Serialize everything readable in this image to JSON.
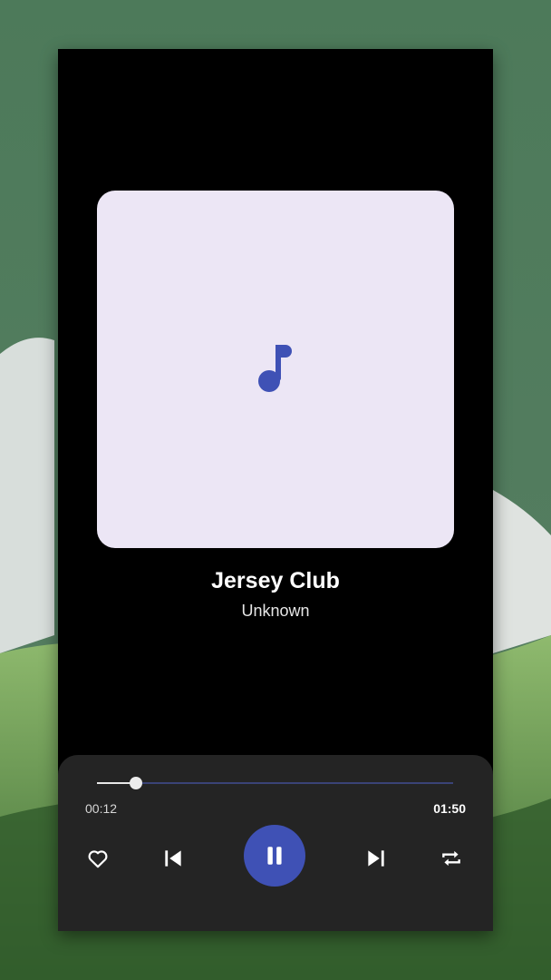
{
  "track": {
    "title": "Jersey Club",
    "artist": "Unknown"
  },
  "progress": {
    "elapsed": "00:12",
    "total": "01:50",
    "fraction": 0.11
  },
  "controls": {
    "favorite_icon": "heart-outline-icon",
    "previous_icon": "skip-previous-icon",
    "play_state_icon": "pause-icon",
    "next_icon": "skip-next-icon",
    "repeat_icon": "repeat-icon"
  },
  "artwork": {
    "icon": "music-note-icon"
  },
  "colors": {
    "accent": "#3f51b5",
    "artwork_bg": "#ece6f5",
    "player_bg": "#000000",
    "panel_bg": "#242424"
  }
}
